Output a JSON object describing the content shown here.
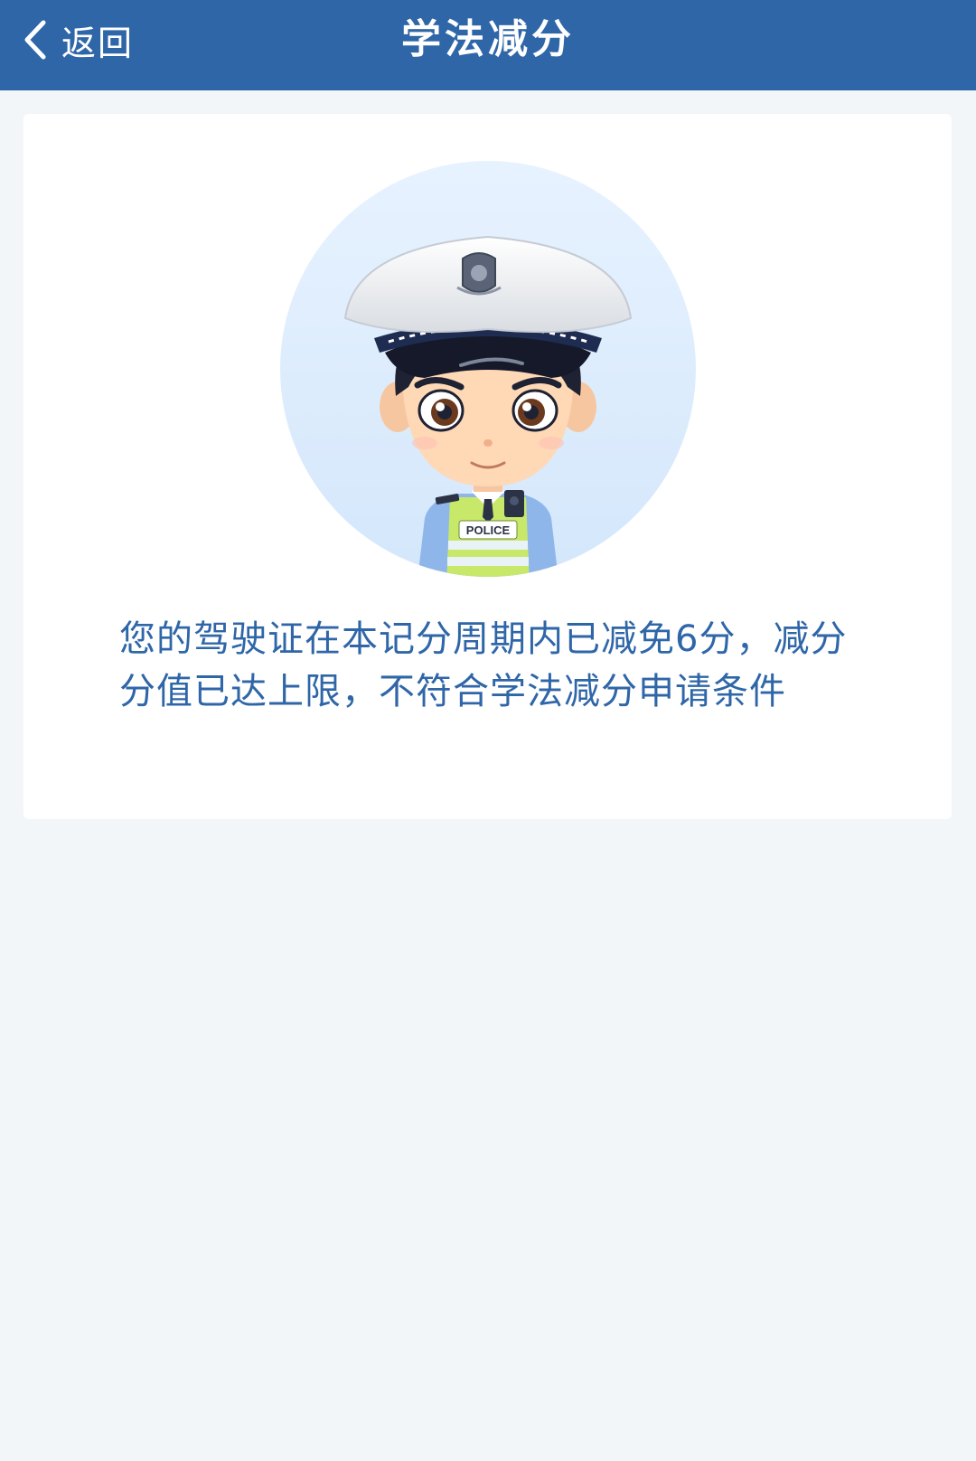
{
  "nav": {
    "back_label": "返回",
    "title": "学法减分"
  },
  "card": {
    "avatar_icon": "police-officer-avatar",
    "badge_text": "POLICE",
    "message": "您的驾驶证在本记分周期内已减免6分，减分分值已达上限，不符合学法减分申请条件"
  },
  "colors": {
    "navbar": "#2f66a8",
    "page_background": "#f2f6f9",
    "message_text": "#2f66a8",
    "avatar_circle": "#deeeff"
  }
}
